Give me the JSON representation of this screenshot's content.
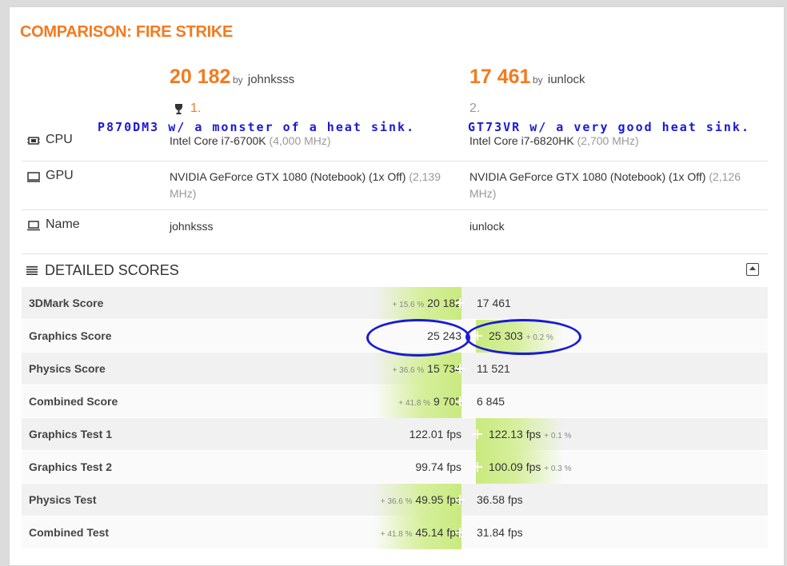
{
  "title": "COMPARISON: FIRE STRIKE",
  "left": {
    "score": "20 182",
    "by": "by",
    "user": "johnksss",
    "rank": "1.",
    "annotation": "P870DM3 w/ a monster of a heat sink.",
    "cpu_name": "Intel Core i7-6700K",
    "cpu_clock": "(4,000 MHz)",
    "gpu_name": "NVIDIA GeForce GTX 1080 (Notebook) (1x Off)",
    "gpu_clock_a": "(2,139",
    "gpu_clock_b": "MHz)",
    "name": "johnksss"
  },
  "right": {
    "score": "17 461",
    "by": "by",
    "user": "iunlock",
    "rank": "2.",
    "annotation": "GT73VR w/ a very good heat sink.",
    "cpu_name": "Intel Core i7-6820HK",
    "cpu_clock": "(2,700 MHz)",
    "gpu_name": "NVIDIA GeForce GTX 1080 (Notebook) (1x Off)",
    "gpu_clock_a": "(2,126",
    "gpu_clock_b": "MHz)",
    "name": "iunlock"
  },
  "rows": {
    "cpu": "CPU",
    "gpu": "GPU",
    "name": "Name"
  },
  "detailed": {
    "title": "DETAILED SCORES",
    "items": [
      {
        "label": "3DMark Score",
        "left": "20 182",
        "right": "17 461",
        "pct": "+ 15.6 %",
        "winner": "left"
      },
      {
        "label": "Graphics Score",
        "left": "25 243",
        "right": "25 303",
        "pct": "+ 0.2 %",
        "winner": "right"
      },
      {
        "label": "Physics Score",
        "left": "15 734",
        "right": "11 521",
        "pct": "+ 36.6 %",
        "winner": "left"
      },
      {
        "label": "Combined Score",
        "left": "9 705",
        "right": "6 845",
        "pct": "+ 41.8 %",
        "winner": "left"
      },
      {
        "label": "Graphics Test 1",
        "left": "122.01 fps",
        "right": "122.13 fps",
        "pct": "+ 0.1 %",
        "winner": "right"
      },
      {
        "label": "Graphics Test 2",
        "left": "99.74 fps",
        "right": "100.09 fps",
        "pct": "+ 0.3 %",
        "winner": "right"
      },
      {
        "label": "Physics Test",
        "left": "49.95 fps",
        "right": "36.58 fps",
        "pct": "+ 36.6 %",
        "winner": "left"
      },
      {
        "label": "Combined Test",
        "left": "45.14 fps",
        "right": "31.84 fps",
        "pct": "+ 41.8 %",
        "winner": "left"
      }
    ]
  },
  "colors": {
    "accent": "#f47a20",
    "annotation": "#1a1ad4",
    "winner_highlight": "#c9ea7f"
  },
  "icons": {
    "trophy": "trophy-icon",
    "cpu": "cpu-chip-icon",
    "gpu": "monitor-icon",
    "name": "laptop-icon",
    "detailed": "hamburger-menu-icon",
    "collapse": "collapse-up-icon"
  }
}
